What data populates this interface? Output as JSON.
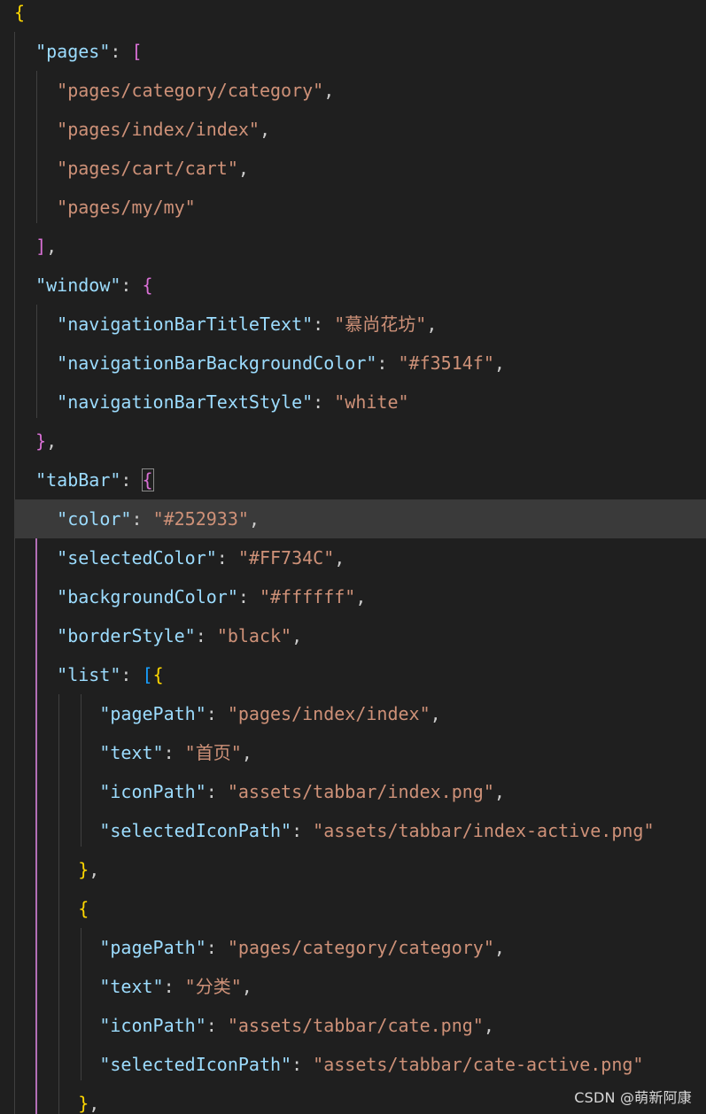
{
  "editor": {
    "language": "json",
    "current_line_index": 13,
    "lines": [
      "{",
      "  \"pages\": [",
      "    \"pages/category/category\",",
      "    \"pages/index/index\",",
      "    \"pages/cart/cart\",",
      "    \"pages/my/my\"",
      "  ],",
      "  \"window\": {",
      "    \"navigationBarTitleText\": \"慕尚花坊\",",
      "    \"navigationBarBackgroundColor\": \"#f3514f\",",
      "    \"navigationBarTextStyle\": \"white\"",
      "  },",
      "  \"tabBar\": {",
      "    \"color\": \"#252933\",",
      "    \"selectedColor\": \"#FF734C\",",
      "    \"backgroundColor\": \"#ffffff\",",
      "    \"borderStyle\": \"black\",",
      "    \"list\": [{",
      "        \"pagePath\": \"pages/index/index\",",
      "        \"text\": \"首页\",",
      "        \"iconPath\": \"assets/tabbar/index.png\",",
      "        \"selectedIconPath\": \"assets/tabbar/index-active.png\"",
      "      },",
      "      {",
      "        \"pagePath\": \"pages/category/category\",",
      "        \"text\": \"分类\",",
      "        \"iconPath\": \"assets/tabbar/cate.png\",",
      "        \"selectedIconPath\": \"assets/tabbar/cate-active.png\"",
      "      },"
    ]
  },
  "watermark": {
    "text": "CSDN @萌新阿康"
  },
  "colors": {
    "background": "#1f1f1f",
    "current_line": "#3a3a3a",
    "key": "#9cdcfe",
    "string": "#ce9178",
    "punctuation": "#cccccc",
    "bracket_level_1": "#ffd700",
    "bracket_level_2": "#da70d6",
    "bracket_level_3": "#179fff"
  }
}
